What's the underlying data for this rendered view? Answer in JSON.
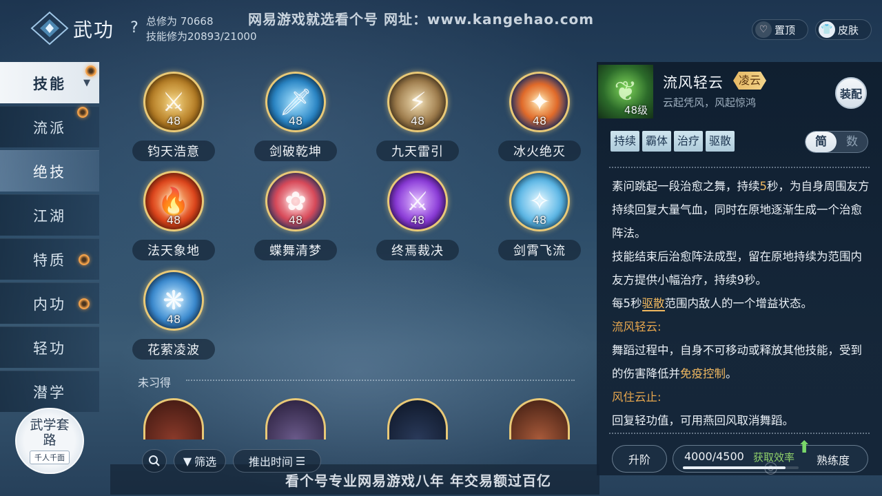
{
  "header": {
    "title": "武功",
    "stat_total": "总修为 70668",
    "stat_skill": "技能修为20893/21000",
    "watermark": "网易游戏就选看个号   网址：www.kangehao.com",
    "pin_label": "置顶",
    "skin_label": "皮肤"
  },
  "sidebar": {
    "items": [
      {
        "label": "技能"
      },
      {
        "label": "流派"
      },
      {
        "label": "绝技"
      },
      {
        "label": "江湖"
      },
      {
        "label": "特质"
      },
      {
        "label": "内功"
      },
      {
        "label": "轻功"
      },
      {
        "label": "潜学"
      }
    ],
    "route_title": "武学套路",
    "route_sub": "千人千面"
  },
  "skills": [
    {
      "name": "钧天浩意",
      "level": "48"
    },
    {
      "name": "剑破乾坤",
      "level": "48"
    },
    {
      "name": "九天雷引",
      "level": "48"
    },
    {
      "name": "冰火绝灭",
      "level": "48"
    },
    {
      "name": "法天象地",
      "level": "48"
    },
    {
      "name": "蝶舞清梦",
      "level": "48"
    },
    {
      "name": "终焉裁决",
      "level": "48"
    },
    {
      "name": "剑霄飞流",
      "level": "48"
    },
    {
      "name": "花萦凌波",
      "level": "48"
    }
  ],
  "unlearned_label": "未习得",
  "bottom": {
    "filter_label": "筛选",
    "sort_label": "推出时间",
    "watermark": "看个号专业网易游戏八年  年交易额过百亿"
  },
  "detail": {
    "name": "流风轻云",
    "tag": "凌云",
    "subtitle": "云起凭风，风起惊鸿",
    "level": "48级",
    "equip_label": "装配",
    "tags": [
      "持续",
      "霸体",
      "治疗",
      "驱散"
    ],
    "toggle_simple": "简",
    "toggle_number": "数",
    "desc": {
      "l1_a": "素问跳起一段治愈之舞，持续",
      "l1_b": "5",
      "l1_c": "秒，为自身周围友方持续回复大量气血，同时在原地逐渐生成一个治愈阵法。",
      "l2": "技能结束后治愈阵法成型，留在原地持续为范围内友方提供小幅治疗，持续9秒。",
      "l3_a": "每5秒",
      "l3_b": "驱散",
      "l3_c": "范围内敌人的一个增益状态。",
      "h1": "流风轻云:",
      "l4_a": "舞蹈过程中，自身不可移动或释放其他技能，受到的伤害降低并",
      "l4_b": "免疫控制",
      "l4_c": "。",
      "h2": "风住云止:",
      "l5": "回复轻功值，可用燕回风取消舞蹈。"
    },
    "upgrade_label": "升阶",
    "progress_value": "4000/4500",
    "progress_fraction": 0.889,
    "efficiency_label": "获取效率",
    "proficiency_label": "熟练度"
  },
  "colors": {
    "accent_gold": "#e9c977",
    "highlight": "#f0b860",
    "badge_orange": "#f2a14a"
  }
}
